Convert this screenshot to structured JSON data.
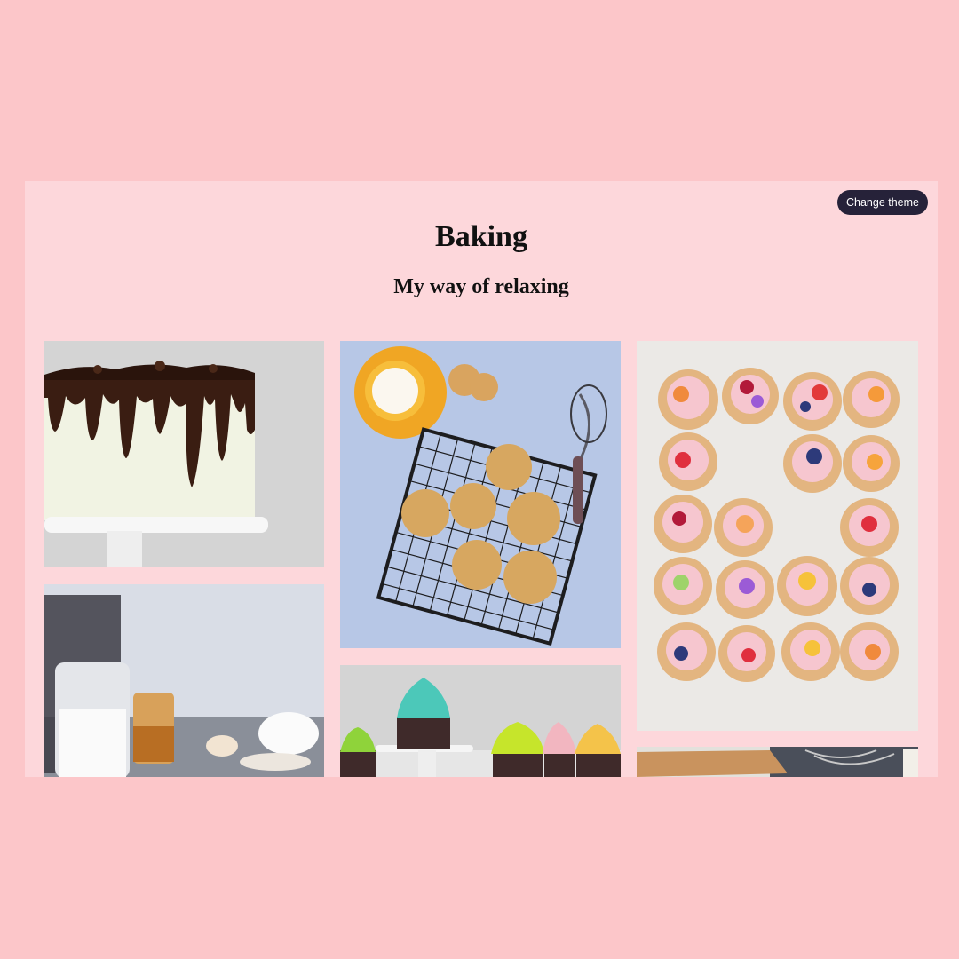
{
  "header": {
    "title": "Baking",
    "subtitle": "My way of relaxing"
  },
  "toolbar": {
    "change_theme_label": "Change theme"
  },
  "colors": {
    "page_bg": "#fcc6c9",
    "panel_bg": "#fdd7db",
    "button_bg": "#262239"
  },
  "gallery": {
    "items": [
      {
        "icon": "drip-cake-photo"
      },
      {
        "icon": "cookies-on-rack-photo"
      },
      {
        "icon": "fruit-tarts-photo"
      },
      {
        "icon": "baking-ingredients-photo"
      },
      {
        "icon": "cupcakes-photo"
      },
      {
        "icon": "rolling-pin-photo"
      }
    ]
  }
}
